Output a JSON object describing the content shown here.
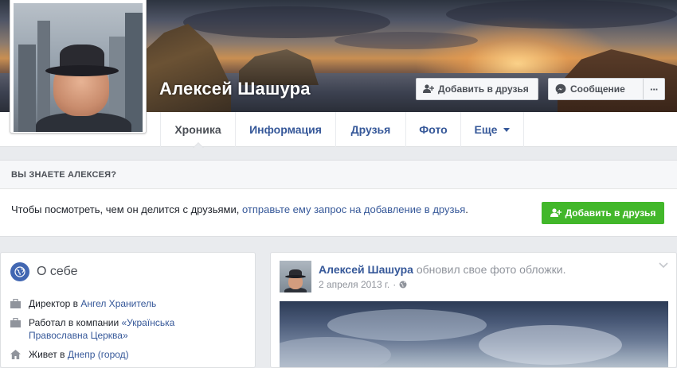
{
  "profile": {
    "name": "Алексей Шашура"
  },
  "cover_actions": {
    "add_friend": "Добавить в друзья",
    "message": "Сообщение",
    "more": "···"
  },
  "nav": {
    "tabs": [
      {
        "label": "Хроника",
        "active": true
      },
      {
        "label": "Информация",
        "active": false
      },
      {
        "label": "Друзья",
        "active": false
      },
      {
        "label": "Фото",
        "active": false
      },
      {
        "label": "Еще",
        "active": false
      }
    ]
  },
  "know_panel": {
    "heading": "ВЫ ЗНАЕТЕ АЛЕКСЕЯ?",
    "text": "Чтобы посмотреть, чем он делится с друзьями,",
    "link": "отправьте ему запрос на добавление в друзья",
    "link_suffix": ".",
    "button": "Добавить в друзья"
  },
  "about": {
    "title": "О себе",
    "rows": [
      {
        "icon": "briefcase-icon",
        "prefix": "Директор в",
        "link": "Ангел Хранитель",
        "suffix": ""
      },
      {
        "icon": "briefcase-icon",
        "prefix": "Работал в компании",
        "link": "«Українська Православна Церква»",
        "suffix": ""
      },
      {
        "icon": "house-icon",
        "prefix": "Живет в",
        "link": "Днепр (город)",
        "suffix": ""
      }
    ]
  },
  "post": {
    "author": "Алексей Шашура",
    "action": "обновил свое фото обложки.",
    "date": "2 апреля 2013 г.",
    "privacy_icon": "globe-icon"
  },
  "colors": {
    "link": "#365899",
    "green_button": "#42b72a",
    "background": "#e9ebee"
  }
}
